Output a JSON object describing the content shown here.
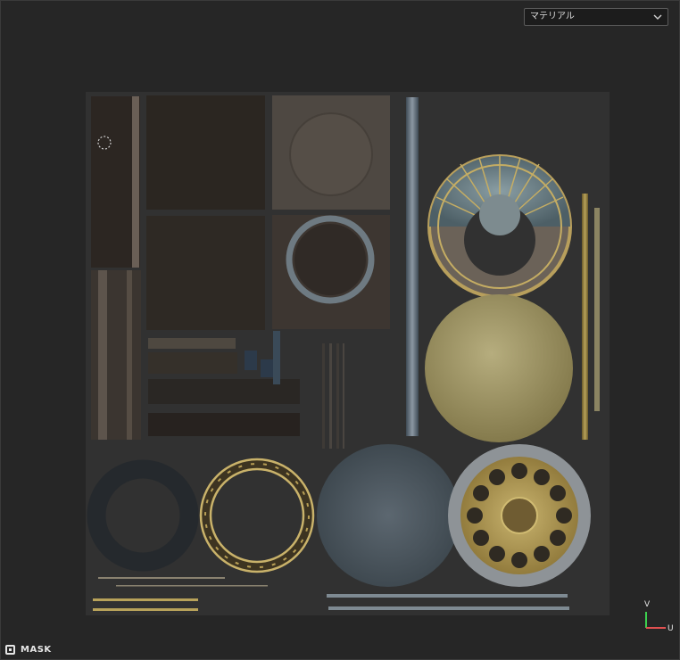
{
  "material_select": {
    "value": "マテリアル"
  },
  "axes": {
    "v": "V",
    "u": "U"
  },
  "mask_toggle": {
    "label": "MASK"
  },
  "colors": {
    "background": "#262626",
    "uv_sheet": "#313131",
    "axis_v": "#3ccf4e",
    "axis_u": "#e05050"
  }
}
